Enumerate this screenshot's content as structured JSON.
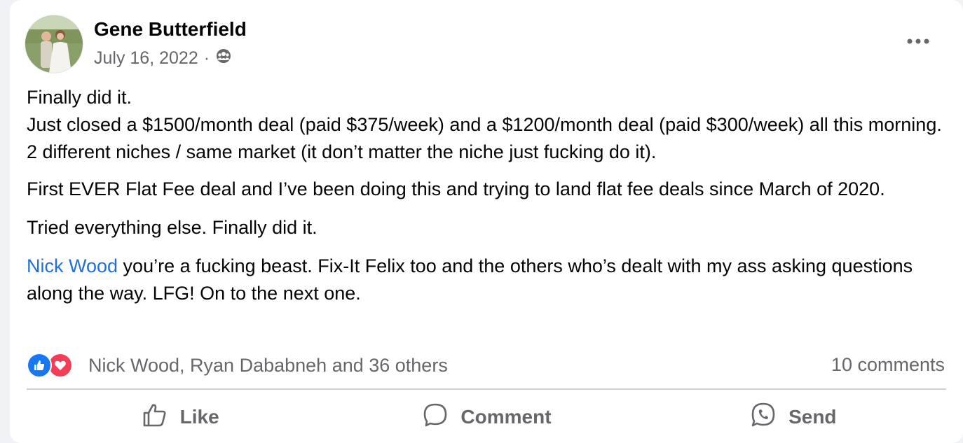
{
  "post": {
    "author": "Gene Butterfield",
    "date": "July 16, 2022",
    "separator": "·",
    "privacy_icon": "group-icon",
    "more_icon": "more-options-icon",
    "body": {
      "p1_line1": "Finally did it.",
      "p1_line2": "Just closed a $1500/month deal (paid $375/week) and a $1200/month deal (paid $300/week) all this morning. 2 different niches / same market (it don’t matter the niche just fucking do it).",
      "p2": "First EVER Flat Fee deal and I’ve been doing this and trying to land flat fee deals since March of 2020.",
      "p3": "Tried everything else. Finally did it.",
      "p4_mention": "Nick Wood",
      "p4_rest": " you’re a fucking beast. Fix-It Felix too and the others who’s dealt with my ass asking questions along the way. LFG! On to the next one."
    },
    "reactions": {
      "icons": [
        "like-reaction-icon",
        "love-reaction-icon"
      ],
      "summary": "Nick Wood, Ryan Dababneh and 36 others"
    },
    "comments_count": "10 comments",
    "actions": {
      "like": "Like",
      "comment": "Comment",
      "send": "Send"
    }
  },
  "colors": {
    "accent": "#216fdb",
    "secondary_text": "#65676b",
    "like_blue": "#1877f2",
    "love_red": "#f33e58"
  }
}
